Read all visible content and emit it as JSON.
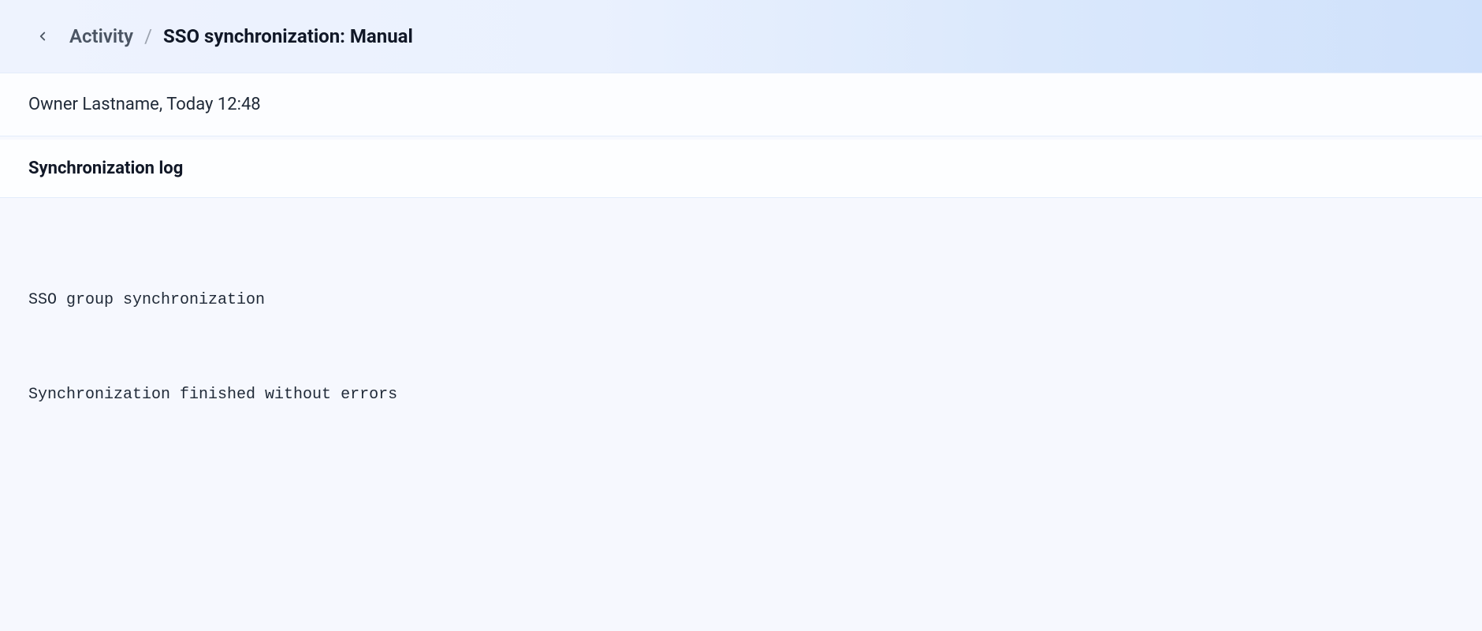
{
  "breadcrumb": {
    "back_label": "Back",
    "parent": "Activity",
    "separator": "/",
    "current": "SSO synchronization: Manual"
  },
  "info": {
    "owner_and_time": "Owner Lastname, Today 12:48"
  },
  "section": {
    "title": "Synchronization log"
  },
  "log": {
    "lines": [
      "SSO group synchronization",
      "Synchronization finished without errors"
    ]
  }
}
